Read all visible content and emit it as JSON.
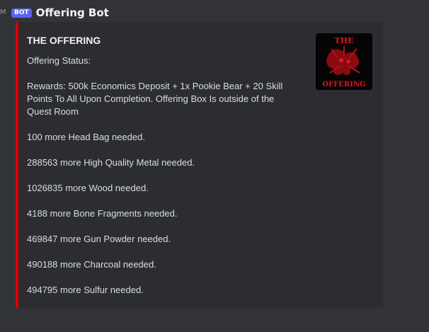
{
  "timestamp_fragment": "M",
  "message": {
    "bot_tag": "BOT",
    "author": "Offering Bot"
  },
  "embed": {
    "accent_color": "#e00000",
    "title": "THE OFFERING",
    "thumbnail": {
      "icon": "the-offering-logo",
      "text_top": "THE",
      "text_bottom": "OFFERING"
    },
    "description": {
      "status_line": "Offering Status:",
      "rewards_lines": [
        "Rewards: 500k Economics Deposit + 1x Pookie Bear + 20 Skill",
        "Points To All Upon Completion. Offering Box Is outside of the",
        "Quest Room"
      ],
      "requirements": [
        "100 more Head Bag needed.",
        "288563 more High Quality Metal needed.",
        "1026835 more Wood needed.",
        "4188 more Bone Fragments needed.",
        "469847 more Gun Powder needed.",
        "490188 more Charcoal needed.",
        "494795 more Sulfur needed."
      ]
    }
  }
}
